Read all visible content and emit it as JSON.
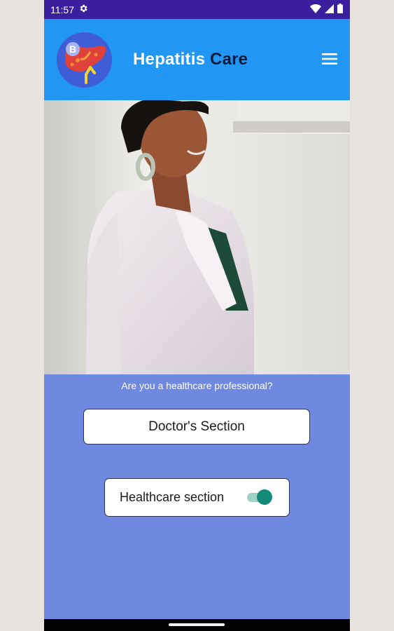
{
  "status_bar": {
    "time": "11:57",
    "icons": [
      "settings-icon",
      "wifi-icon",
      "signal-icon",
      "battery-icon"
    ]
  },
  "app_bar": {
    "title_part1": "Hepatitis",
    "title_part2": "Care",
    "logo_icon": "liver-logo-icon",
    "logo_letter": "B",
    "menu_icon": "hamburger-menu-icon",
    "colors": {
      "background": "#2196f3",
      "title_primary": "#ffffff",
      "title_secondary": "#0d1b3a"
    }
  },
  "hero": {
    "image": "photo of a smiling healthcare professional in a white coat"
  },
  "main": {
    "question": "Are you a healthcare professional?",
    "doctor_button_label": "Doctor's Section",
    "healthcare_label": "Healthcare section",
    "healthcare_toggle_on": true,
    "colors": {
      "background": "#6f88e0",
      "toggle": "#138a77"
    }
  }
}
